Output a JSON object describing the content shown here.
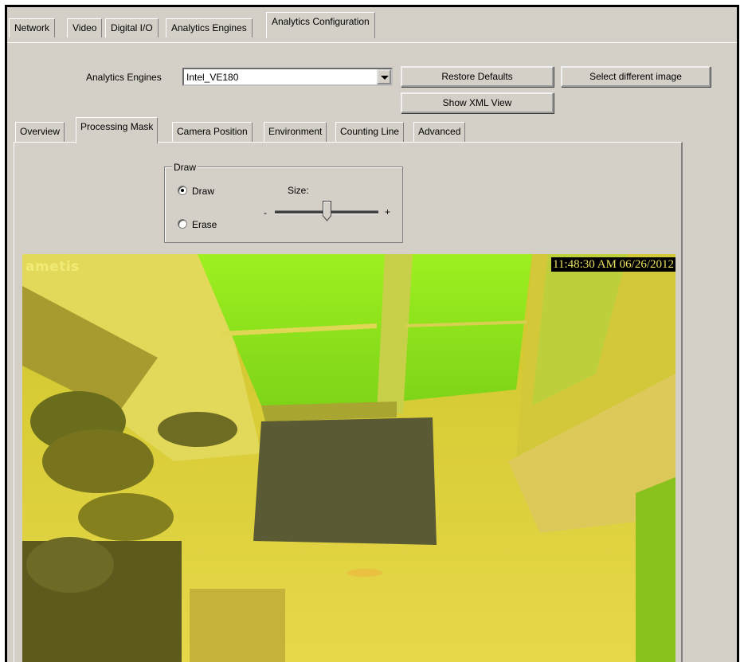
{
  "top_tabs": [
    {
      "label": "Network"
    },
    {
      "label": "Video"
    },
    {
      "label": "Digital I/O"
    },
    {
      "label": "Analytics Engines"
    },
    {
      "label": "Analytics Configuration",
      "active": true
    }
  ],
  "engine": {
    "label": "Analytics Engines",
    "selected": "Intel_VE180"
  },
  "buttons": {
    "restore_defaults": "Restore Defaults",
    "select_image": "Select different image",
    "show_xml": "Show XML View"
  },
  "sub_tabs": [
    {
      "label": "Overview"
    },
    {
      "label": "Processing Mask",
      "active": true
    },
    {
      "label": "Camera Position"
    },
    {
      "label": "Environment"
    },
    {
      "label": "Counting Line"
    },
    {
      "label": "Advanced"
    }
  ],
  "draw_group": {
    "legend": "Draw",
    "options": [
      "Draw",
      "Erase"
    ],
    "selected": "Draw",
    "size_label": "Size:",
    "minus": "-",
    "plus": "+",
    "size_fraction": 0.5
  },
  "video": {
    "logo": "ametis",
    "timestamp": "11:48:30 AM 06/26/2012"
  }
}
